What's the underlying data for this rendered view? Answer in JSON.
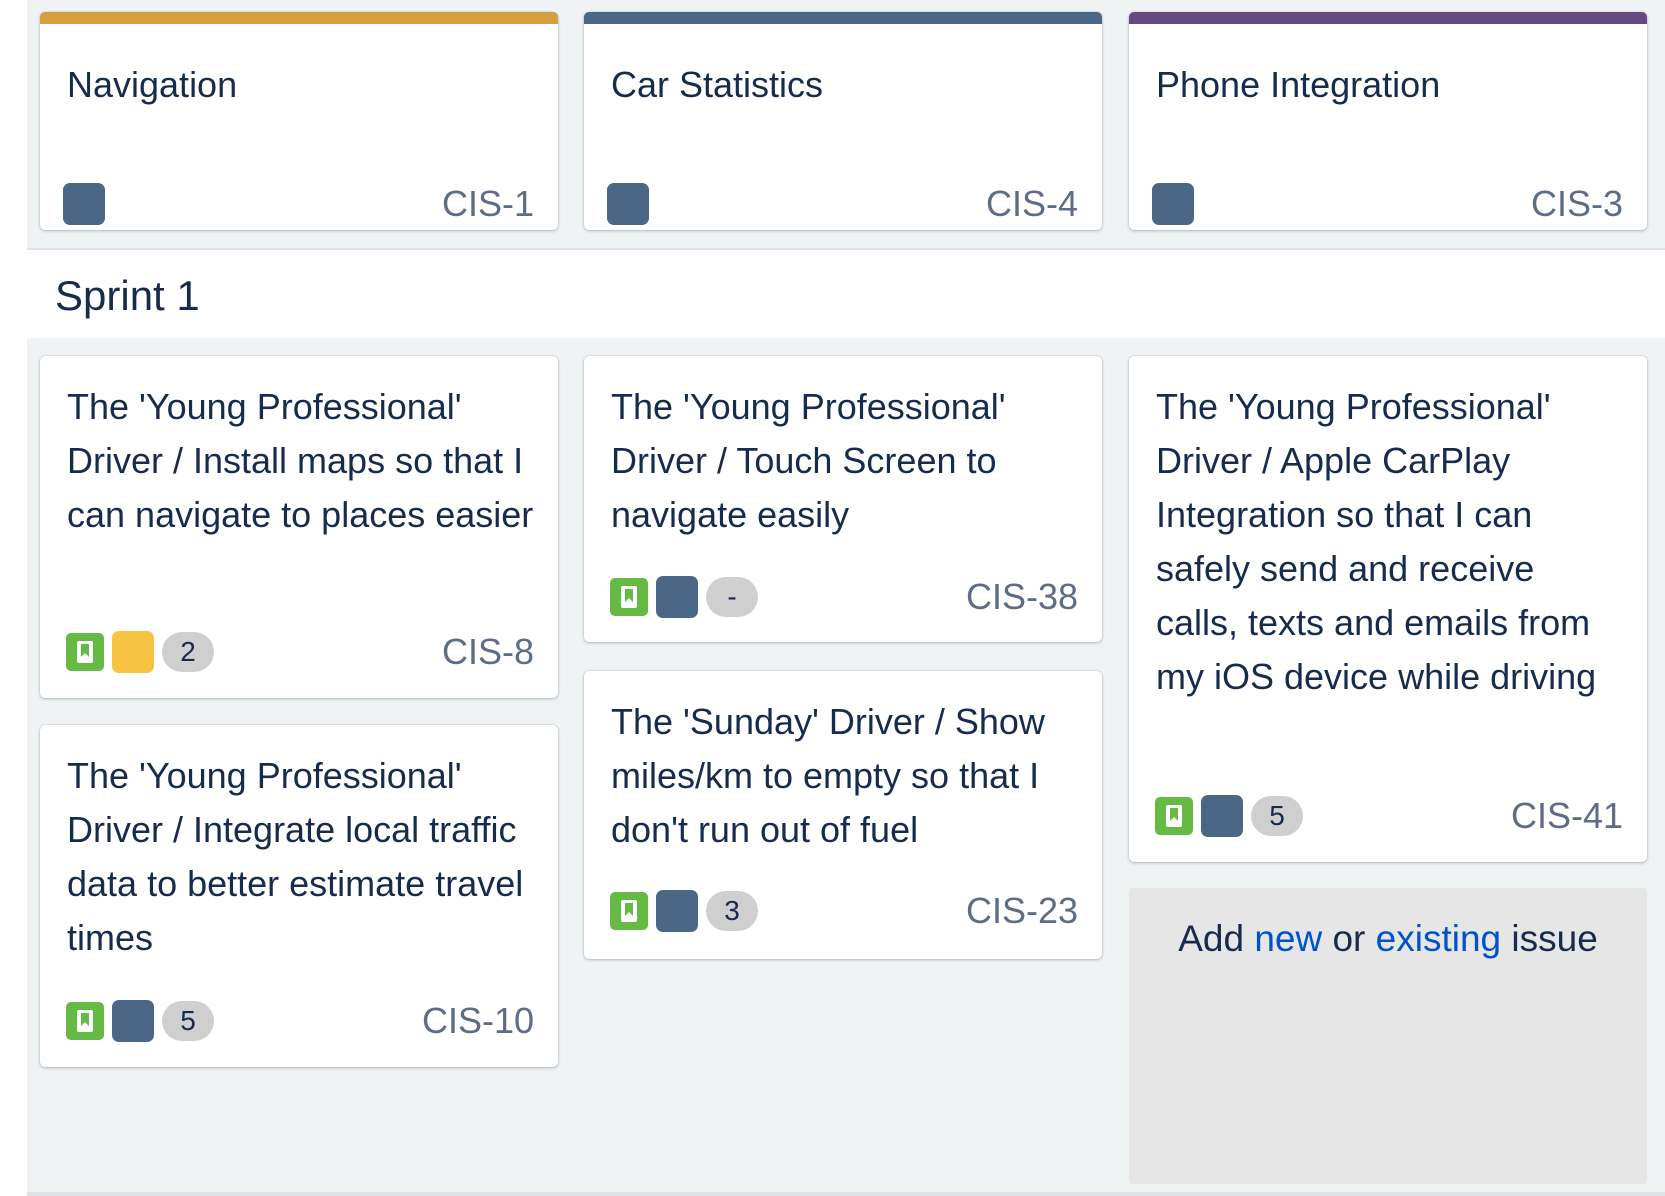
{
  "colors": {
    "board_bg": "#f0f3f4",
    "epic_navigation": "#d59e3f",
    "epic_car_statistics": "#4a6785",
    "epic_phone_integration": "#654982",
    "story_green": "#65ba43",
    "epic_blue": "#4a6785",
    "epic_yellow": "#f6c342",
    "link_blue": "#0052cc"
  },
  "epics": [
    {
      "title": "Navigation",
      "key": "CIS-1",
      "icon": "epic-square"
    },
    {
      "title": "Car Statistics",
      "key": "CIS-4",
      "icon": "epic-square"
    },
    {
      "title": "Phone Integration",
      "key": "CIS-3",
      "icon": "epic-square"
    }
  ],
  "sprint": {
    "title": "Sprint 1"
  },
  "issues": [
    {
      "summary": "The 'Young Professional' Driver / Install maps so that I can navigate to places easier",
      "key": "CIS-8",
      "estimate": "2",
      "type_icon": "story-bookmark-icon",
      "epic_color": "yellow"
    },
    {
      "summary": "The 'Young Professional' Driver / Integrate local traffic data to better estimate travel times",
      "key": "CIS-10",
      "estimate": "5",
      "type_icon": "story-bookmark-icon",
      "epic_color": "blue"
    },
    {
      "summary": "The 'Young Professional' Driver / Touch Screen to navigate easily",
      "key": "CIS-38",
      "estimate": "-",
      "type_icon": "story-bookmark-icon",
      "epic_color": "blue"
    },
    {
      "summary": "The 'Sunday' Driver / Show miles/km to empty so that I don't run out of fuel",
      "key": "CIS-23",
      "estimate": "3",
      "type_icon": "story-bookmark-icon",
      "epic_color": "blue"
    },
    {
      "summary": "The 'Young Professional' Driver / Apple CarPlay Integration so that I can safely send and receive calls, texts and emails from my iOS device while driving",
      "key": "CIS-41",
      "estimate": "5",
      "type_icon": "story-bookmark-icon",
      "epic_color": "blue"
    }
  ],
  "add_issue": {
    "prefix": "Add",
    "new_link": "new",
    "or": "or",
    "existing_link": "existing",
    "suffix": "issue"
  }
}
